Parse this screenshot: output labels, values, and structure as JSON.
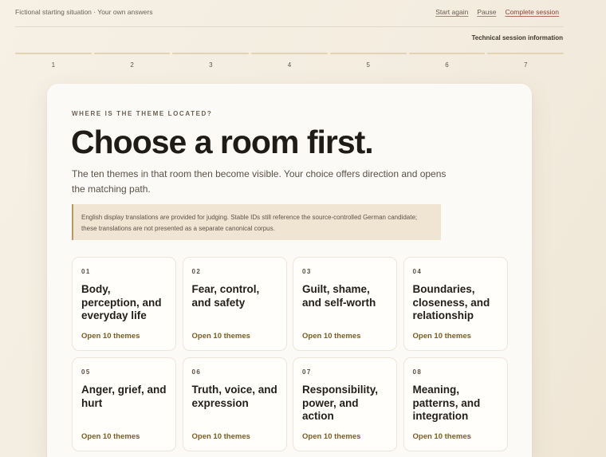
{
  "header": {
    "context": "Fictional starting situation · Your own answers",
    "actions": {
      "start_again": "Start again",
      "pause": "Pause",
      "complete": "Complete session"
    },
    "technical_info": "Technical session information"
  },
  "steps": [
    "1",
    "2",
    "3",
    "4",
    "5",
    "6",
    "7"
  ],
  "main": {
    "eyebrow": "WHERE IS THE THEME LOCATED?",
    "headline": "Choose a room first.",
    "lead": "The ten themes in that room then become visible. Your choice offers direction and opens the matching path.",
    "notice": "English display translations are provided for judging. Stable IDs still reference the source-controlled German candidate; these translations are not presented as a separate canonical corpus."
  },
  "rooms": [
    {
      "no": "01",
      "title": "Body, perception, and everyday life",
      "open": "Open 10 themes"
    },
    {
      "no": "02",
      "title": "Fear, control, and safety",
      "open": "Open 10 themes"
    },
    {
      "no": "03",
      "title": "Guilt, shame, and self-worth",
      "open": "Open 10 themes"
    },
    {
      "no": "04",
      "title": "Boundaries, closeness, and relationship",
      "open": "Open 10 themes"
    },
    {
      "no": "05",
      "title": "Anger, grief, and hurt",
      "open": "Open 10 themes"
    },
    {
      "no": "06",
      "title": "Truth, voice, and expression",
      "open": "Open 10 themes"
    },
    {
      "no": "07",
      "title": "Responsibility, power, and action",
      "open": "Open 10 themes"
    },
    {
      "no": "08",
      "title": "Meaning, patterns, and integration",
      "open": "Open 10 themes"
    }
  ]
}
